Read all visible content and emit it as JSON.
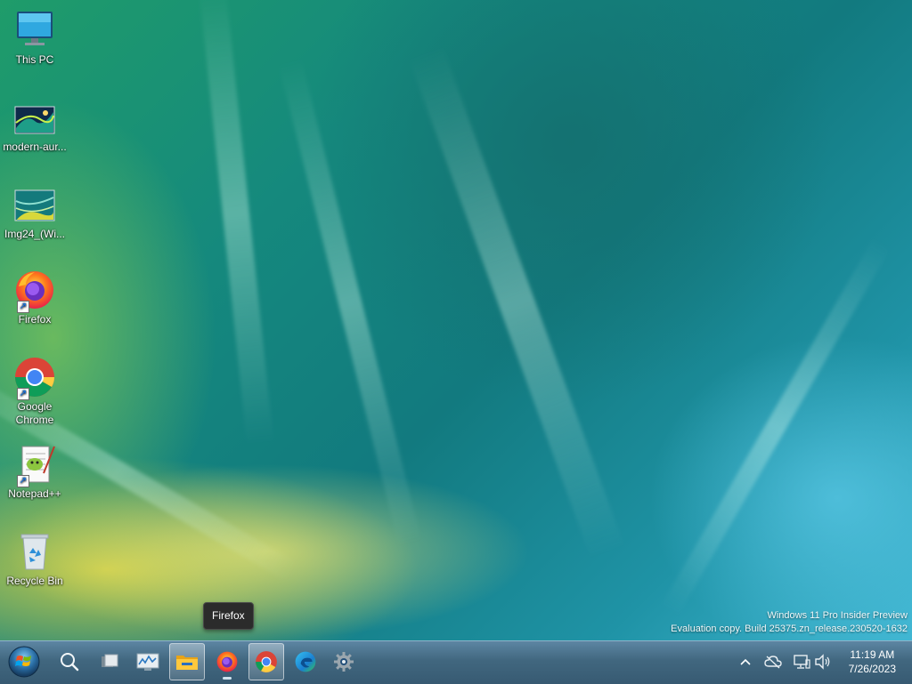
{
  "desktop": {
    "icons": [
      {
        "label": "This PC",
        "icon": "monitor-icon"
      },
      {
        "label": "modern-aur...",
        "icon": "image-file-icon"
      },
      {
        "label": "Img24_(Wi...",
        "icon": "image-file-icon"
      },
      {
        "label": "Firefox",
        "icon": "firefox-icon",
        "shortcut": true
      },
      {
        "label": "Google Chrome",
        "icon": "chrome-icon",
        "shortcut": true
      },
      {
        "label": "Notepad++",
        "icon": "notepadpp-icon",
        "shortcut": true
      },
      {
        "label": "Recycle Bin",
        "icon": "recycle-bin-icon"
      }
    ],
    "watermark": {
      "line1": "Windows 11 Pro Insider Preview",
      "line2": "Evaluation copy. Build 25375.zn_release.230520-1632"
    }
  },
  "tooltip": {
    "text": "Firefox"
  },
  "taskbar": {
    "buttons": [
      {
        "name": "start-button",
        "icon": "windows-logo-icon"
      },
      {
        "name": "search",
        "icon": "search-icon"
      },
      {
        "name": "task-view",
        "icon": "task-view-icon"
      },
      {
        "name": "task-manager",
        "icon": "resource-monitor-icon"
      },
      {
        "name": "file-explorer",
        "icon": "folder-icon",
        "active": true
      },
      {
        "name": "firefox",
        "icon": "firefox-icon",
        "running": true
      },
      {
        "name": "chrome",
        "icon": "chrome-icon",
        "active": true
      },
      {
        "name": "edge",
        "icon": "edge-icon"
      },
      {
        "name": "settings",
        "icon": "gear-icon"
      }
    ],
    "tray": {
      "icons": [
        "chevron-up-icon",
        "cloud-offline-icon",
        "network-icon",
        "volume-icon"
      ],
      "time": "11:19 AM",
      "date": "7/26/2023"
    }
  },
  "colors": {
    "taskbar_top": "#5d86a3",
    "taskbar_bottom": "#375a72",
    "tooltip_bg": "#2b2b2b"
  }
}
